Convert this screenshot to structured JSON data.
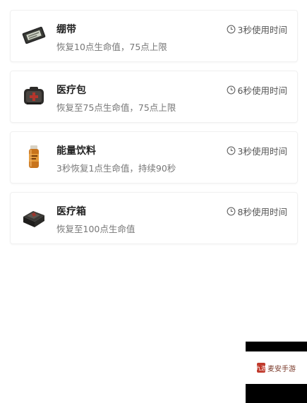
{
  "items": [
    {
      "name": "绷带",
      "description": "恢复10点生命值，75点上限",
      "use_time": "3秒使用时间",
      "icon": "bandage-icon"
    },
    {
      "name": "医疗包",
      "description": "恢复至75点生命值，75点上限",
      "use_time": "6秒使用时间",
      "icon": "medkit-icon"
    },
    {
      "name": "能量饮料",
      "description": "3秒恢复1点生命值，持续90秒",
      "use_time": "3秒使用时间",
      "icon": "energy-drink-icon"
    },
    {
      "name": "医疗箱",
      "description": "恢复至100点生命值",
      "use_time": "8秒使用时间",
      "icon": "medical-case-icon"
    }
  ],
  "watermark": {
    "logo_text": "九游",
    "text": "麦安手游"
  },
  "colors": {
    "card_border": "#f0f0f0",
    "title": "#222222",
    "description": "#777777",
    "use_time": "#555555"
  }
}
